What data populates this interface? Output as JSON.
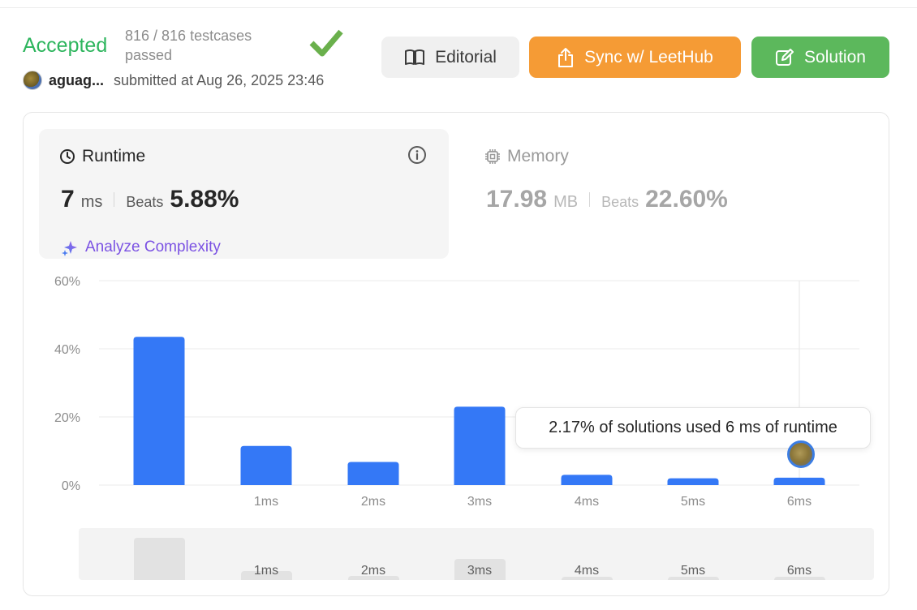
{
  "header": {
    "status": "Accepted",
    "testcases": "816 / 816 testcases passed",
    "author": "aguag...",
    "submitted": "submitted at Aug 26, 2025 23:46"
  },
  "buttons": {
    "editorial": "Editorial",
    "sync": "Sync w/ LeetHub",
    "solution": "Solution"
  },
  "runtime": {
    "title": "Runtime",
    "value": "7",
    "unit": "ms",
    "beats_label": "Beats",
    "beats": "5.88%",
    "analyze": "Analyze Complexity"
  },
  "memory": {
    "title": "Memory",
    "value": "17.98",
    "unit": "MB",
    "beats_label": "Beats",
    "beats": "22.60%"
  },
  "tooltip": "2.17% of solutions used 6 ms of runtime",
  "colors": {
    "accepted": "#2db55d",
    "bar": "#3478f6",
    "sync": "#f59b35",
    "solution": "#5cb85c"
  },
  "chart_data": {
    "type": "bar",
    "categories": [
      "",
      "1ms",
      "2ms",
      "3ms",
      "4ms",
      "5ms",
      "6ms"
    ],
    "values": [
      43.5,
      11.5,
      6.8,
      23.0,
      3.0,
      2.0,
      2.17
    ],
    "y_ticks": [
      "60%",
      "40%",
      "20%",
      "0%"
    ],
    "ylim": [
      0,
      60
    ],
    "grid": true,
    "highlight": "6ms"
  },
  "navigator": {
    "labels": [
      "1ms",
      "2ms",
      "3ms",
      "4ms",
      "5ms",
      "6ms"
    ]
  }
}
